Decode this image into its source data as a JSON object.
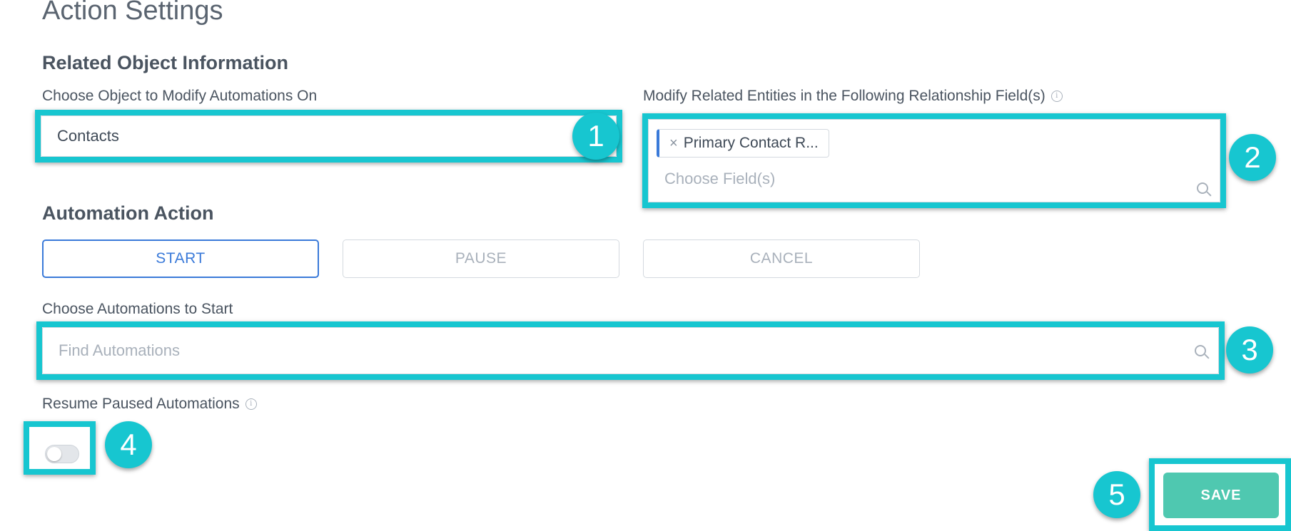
{
  "page": {
    "title": "Action Settings"
  },
  "related_object": {
    "section_title": "Related Object Information",
    "object_label": "Choose Object to Modify Automations On",
    "object_value": "Contacts",
    "relationship_label": "Modify Related Entities in the Following Relationship Field(s)",
    "relationship_chip": "Primary Contact R...",
    "relationship_placeholder": "Choose Field(s)"
  },
  "automation_action": {
    "section_title": "Automation Action",
    "buttons": [
      "START",
      "PAUSE",
      "CANCEL"
    ],
    "selected": "START"
  },
  "automations": {
    "label": "Choose Automations to Start",
    "placeholder": "Find Automations"
  },
  "resume": {
    "label": "Resume Paused Automations",
    "enabled": false
  },
  "save_label": "SAVE",
  "callouts": [
    "1",
    "2",
    "3",
    "4",
    "5"
  ],
  "colors": {
    "highlight": "#17c6d0",
    "accent": "#3a7ad9",
    "save": "#4fc8b0"
  },
  "icons": {
    "info": "info-icon",
    "search": "search-icon",
    "remove": "close-icon"
  }
}
